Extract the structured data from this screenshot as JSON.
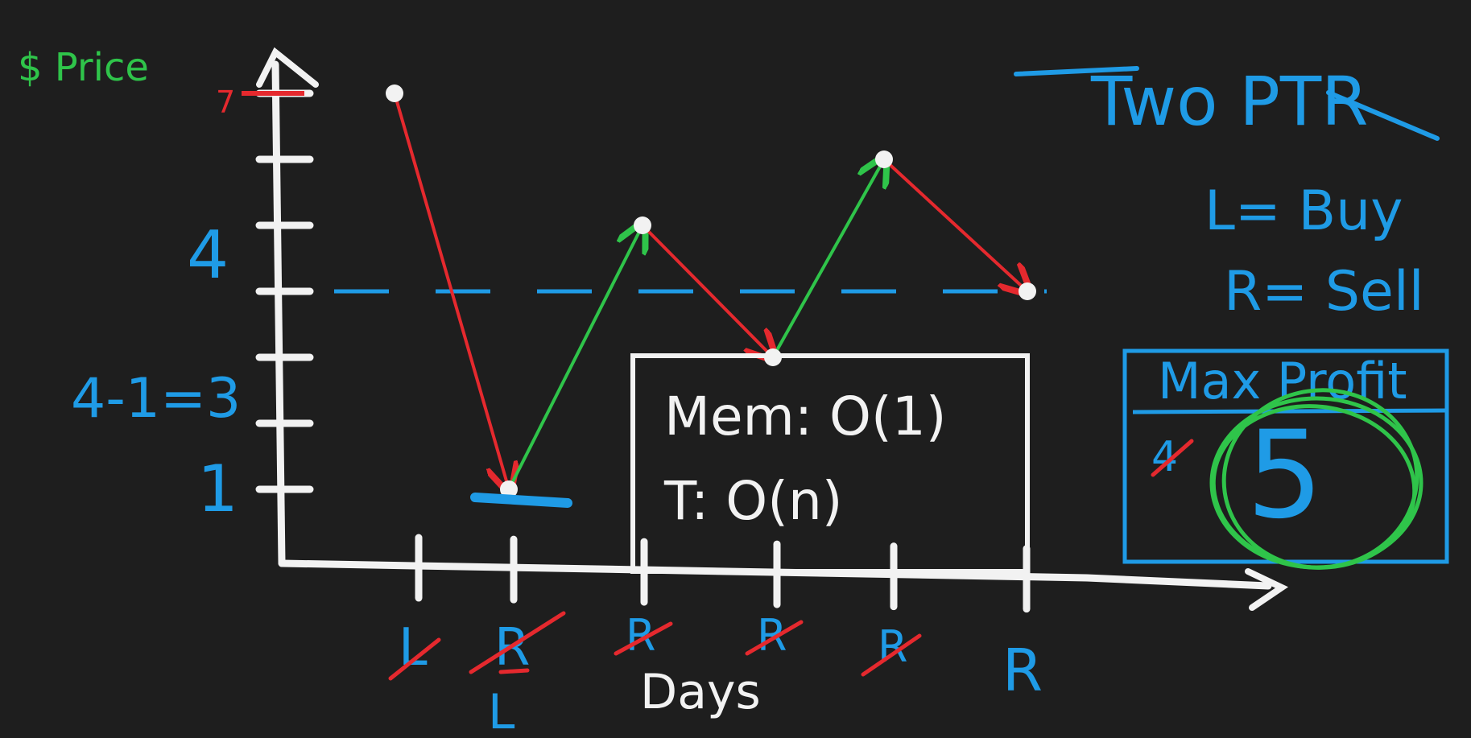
{
  "colors": {
    "background": "#1e1e1e",
    "axis": "#f2f2f2",
    "label_green": "#2fc44a",
    "label_blue": "#1f9be6",
    "arrow_red": "#e5292e",
    "arrow_green": "#2fc44a"
  },
  "axes": {
    "y_label": "$ Price",
    "x_label": "Days",
    "y_tick_labels": [
      {
        "text": "7",
        "value": 7,
        "color": "red"
      },
      {
        "text": "4",
        "value": 4,
        "color": "blue"
      },
      {
        "text": "4-1=3",
        "value": 3,
        "color": "blue"
      },
      {
        "text": "1",
        "value": 1,
        "color": "blue"
      }
    ]
  },
  "chart_data": {
    "type": "line",
    "x": [
      1,
      2,
      3,
      4,
      5,
      6
    ],
    "prices": [
      7,
      1,
      5,
      3,
      6,
      4
    ],
    "ylim": [
      0,
      8
    ],
    "reference_line_value": 4
  },
  "pointer_labels": [
    {
      "text": "L",
      "crossed": true,
      "sub": ""
    },
    {
      "text": "R",
      "crossed": true,
      "sub": "L"
    },
    {
      "text": "R",
      "crossed": true,
      "sub": ""
    },
    {
      "text": "R",
      "crossed": true,
      "sub": ""
    },
    {
      "text": "R",
      "crossed": true,
      "sub": ""
    },
    {
      "text": "R",
      "crossed": false,
      "sub": ""
    }
  ],
  "notes": {
    "title": "Two PTR",
    "legend_l": "L= Buy",
    "legend_r": "R= Sell"
  },
  "complexity_box": {
    "mem": "Mem: O(1)",
    "time": "T: O(n)"
  },
  "max_profit_box": {
    "header": "Max Profit",
    "old_value": "4",
    "value": "5"
  }
}
